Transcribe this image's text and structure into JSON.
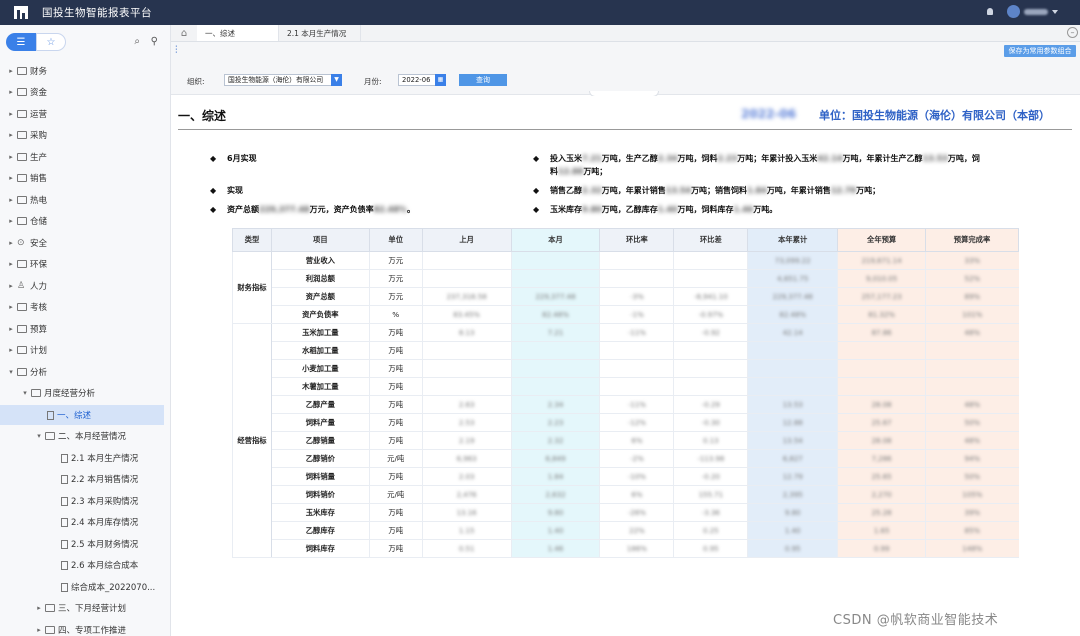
{
  "app": {
    "title": "国投生物智能报表平台",
    "user_name": "用户名"
  },
  "sidebar": {
    "items": [
      {
        "label": "财务"
      },
      {
        "label": "资金"
      },
      {
        "label": "运营"
      },
      {
        "label": "采购"
      },
      {
        "label": "生产"
      },
      {
        "label": "销售"
      },
      {
        "label": "热电"
      },
      {
        "label": "仓储"
      },
      {
        "label": "安全"
      },
      {
        "label": "环保"
      },
      {
        "label": "人力"
      },
      {
        "label": "考核"
      },
      {
        "label": "预算"
      },
      {
        "label": "计划"
      },
      {
        "label": "分析"
      },
      {
        "label": "月度经营分析"
      },
      {
        "label": "一、综述"
      },
      {
        "label": "二、本月经营情况"
      },
      {
        "label": "2.1 本月生产情况"
      },
      {
        "label": "2.2 本月销售情况"
      },
      {
        "label": "2.3 本月采购情况"
      },
      {
        "label": "2.4 本月库存情况"
      },
      {
        "label": "2.5 本月财务情况"
      },
      {
        "label": "2.6 本月综合成本"
      },
      {
        "label": "综合成本_2022070..."
      },
      {
        "label": "三、下月经营计划"
      },
      {
        "label": "四、专项工作推进"
      }
    ]
  },
  "tabs": [
    {
      "label": "一、综述"
    },
    {
      "label": "2.1 本月生产情况"
    }
  ],
  "filters": {
    "org_label": "组织:",
    "org_value": "国投生物能源（海伦）有限公司",
    "month_label": "月份:",
    "month_value": "2022-06",
    "query_label": "查询",
    "save_label": "保存为常用参数组合"
  },
  "report": {
    "title": "一、综述",
    "date": "2022-06",
    "unit": "单位：国投生物能源（海伦）有限公司（本部）",
    "bullets": {
      "b1": "6月实现",
      "b2": "实现",
      "b3a": "资产总额",
      "b3b": "229,377.48",
      "b3c": "万元，资产负债率",
      "b3d": "82.48%",
      "b3e": "。",
      "r1a": "投入玉米",
      "r1b": "7.21",
      "r1c": "万吨，生产乙醇",
      "r1d": "2.34",
      "r1e": "万吨，饲料",
      "r1f": "2.23",
      "r1g": "万吨；年累计投入玉米",
      "r1h": "42.14",
      "r1i": "万吨，年累计生产乙醇",
      "r1j": "13.53",
      "r1k": "万吨，饲",
      "r1l": "料",
      "r1m": "12.88",
      "r1n": "万吨；",
      "r2a": "销售乙醇",
      "r2b": "2.32",
      "r2c": "万吨，年累计销售",
      "r2d": "13.54",
      "r2e": "万吨；销售饲料",
      "r2f": "1.84",
      "r2g": "万吨，年累计销售",
      "r2h": "12.79",
      "r2i": "万吨；",
      "r3a": "玉米库存",
      "r3b": "9.80",
      "r3c": "万吨，乙醇库存",
      "r3d": "1.40",
      "r3e": "万吨，饲料库存",
      "r3f": "1.46",
      "r3g": "万吨。"
    }
  },
  "table": {
    "headers": [
      "类型",
      "项目",
      "单位",
      "上月",
      "本月",
      "环比率",
      "环比差",
      "本年累计",
      "全年预算",
      "预算完成率"
    ],
    "categories": [
      {
        "label": "财务指标"
      },
      {
        "label": "经营指标"
      }
    ],
    "rows": [
      {
        "item": "营业收入",
        "unit": "万元",
        "prev": "",
        "cur": "",
        "rate": "",
        "diff": "",
        "ytd": "73,099.22",
        "bud": "219,671.14",
        "pct": "33%"
      },
      {
        "item": "利润总额",
        "unit": "万元",
        "prev": "",
        "cur": "",
        "rate": "",
        "diff": "",
        "ytd": "4,651.75",
        "bud": "9,010.05",
        "pct": "52%"
      },
      {
        "item": "资产总额",
        "unit": "万元",
        "prev": "237,318.58",
        "cur": "229,377.48",
        "rate": "-3%",
        "diff": "-8,941.10",
        "ytd": "229,377.48",
        "bud": "257,177.23",
        "pct": "89%"
      },
      {
        "item": "资产负债率",
        "unit": "%",
        "prev": "83.45%",
        "cur": "82.48%",
        "rate": "-1%",
        "diff": "-0.97%",
        "ytd": "82.48%",
        "bud": "81.32%",
        "pct": "101%"
      },
      {
        "item": "玉米加工量",
        "unit": "万吨",
        "prev": "8.13",
        "cur": "7.21",
        "rate": "-11%",
        "diff": "-0.92",
        "ytd": "42.14",
        "bud": "87.86",
        "pct": "48%"
      },
      {
        "item": "水稻加工量",
        "unit": "万吨",
        "prev": "",
        "cur": "",
        "rate": "",
        "diff": "",
        "ytd": "",
        "bud": "",
        "pct": ""
      },
      {
        "item": "小麦加工量",
        "unit": "万吨",
        "prev": "",
        "cur": "",
        "rate": "",
        "diff": "",
        "ytd": "",
        "bud": "",
        "pct": ""
      },
      {
        "item": "木薯加工量",
        "unit": "万吨",
        "prev": "",
        "cur": "",
        "rate": "",
        "diff": "",
        "ytd": "",
        "bud": "",
        "pct": ""
      },
      {
        "item": "乙醇产量",
        "unit": "万吨",
        "prev": "2.63",
        "cur": "2.34",
        "rate": "-11%",
        "diff": "-0.29",
        "ytd": "13.53",
        "bud": "28.08",
        "pct": "48%"
      },
      {
        "item": "饲料产量",
        "unit": "万吨",
        "prev": "2.53",
        "cur": "2.23",
        "rate": "-12%",
        "diff": "-0.30",
        "ytd": "12.88",
        "bud": "25.67",
        "pct": "50%"
      },
      {
        "item": "乙醇销量",
        "unit": "万吨",
        "prev": "2.19",
        "cur": "2.32",
        "rate": "6%",
        "diff": "0.13",
        "ytd": "13.54",
        "bud": "28.08",
        "pct": "48%"
      },
      {
        "item": "乙醇销价",
        "unit": "元/吨",
        "prev": "6,963",
        "cur": "6,849",
        "rate": "-2%",
        "diff": "-113.98",
        "ytd": "6,827",
        "bud": "7,286",
        "pct": "94%"
      },
      {
        "item": "饲料销量",
        "unit": "万吨",
        "prev": "2.03",
        "cur": "1.84",
        "rate": "-10%",
        "diff": "-0.20",
        "ytd": "12.79",
        "bud": "25.65",
        "pct": "50%"
      },
      {
        "item": "饲料销价",
        "unit": "元/吨",
        "prev": "2,476",
        "cur": "2,632",
        "rate": "6%",
        "diff": "155.71",
        "ytd": "2,395",
        "bud": "2,270",
        "pct": "105%"
      },
      {
        "item": "玉米库存",
        "unit": "万吨",
        "prev": "13.16",
        "cur": "9.80",
        "rate": "-26%",
        "diff": "-3.36",
        "ytd": "9.80",
        "bud": "25.28",
        "pct": "39%"
      },
      {
        "item": "乙醇库存",
        "unit": "万吨",
        "prev": "1.15",
        "cur": "1.40",
        "rate": "22%",
        "diff": "0.25",
        "ytd": "1.40",
        "bud": "1.65",
        "pct": "85%"
      },
      {
        "item": "饲料库存",
        "unit": "万吨",
        "prev": "0.51",
        "cur": "1.46",
        "rate": "186%",
        "diff": "0.95",
        "ytd": "0.95",
        "bud": "0.99",
        "pct": "148%"
      }
    ]
  },
  "watermark": "CSDN @帆软商业智能技术"
}
